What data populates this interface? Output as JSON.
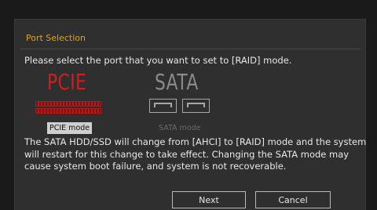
{
  "dialog": {
    "title": "Port Selection",
    "prompt": "Please select the port that you want to set to [RAID] mode.",
    "options": {
      "pcie": {
        "label": "PCIE",
        "mode_label": "PCIE mode",
        "selected": true
      },
      "sata": {
        "label": "SATA",
        "mode_label": "SATA mode",
        "selected": false
      }
    },
    "warning": "The SATA HDD/SSD will change from [AHCI] to [RAID] mode and the system will restart for this change to take effect. Changing the SATA mode may cause system boot failure, and system is not recoverable.",
    "buttons": {
      "next": "Next",
      "cancel": "Cancel"
    }
  },
  "colors": {
    "title": "#d9a31e",
    "selected_red": "#cc1f1f",
    "disabled_gray": "#8a8a8a",
    "background": "#2f2f2f"
  },
  "icons": {
    "pcie_slot": "pcie-slot-icon",
    "sata_ports": "sata-port-icon"
  }
}
